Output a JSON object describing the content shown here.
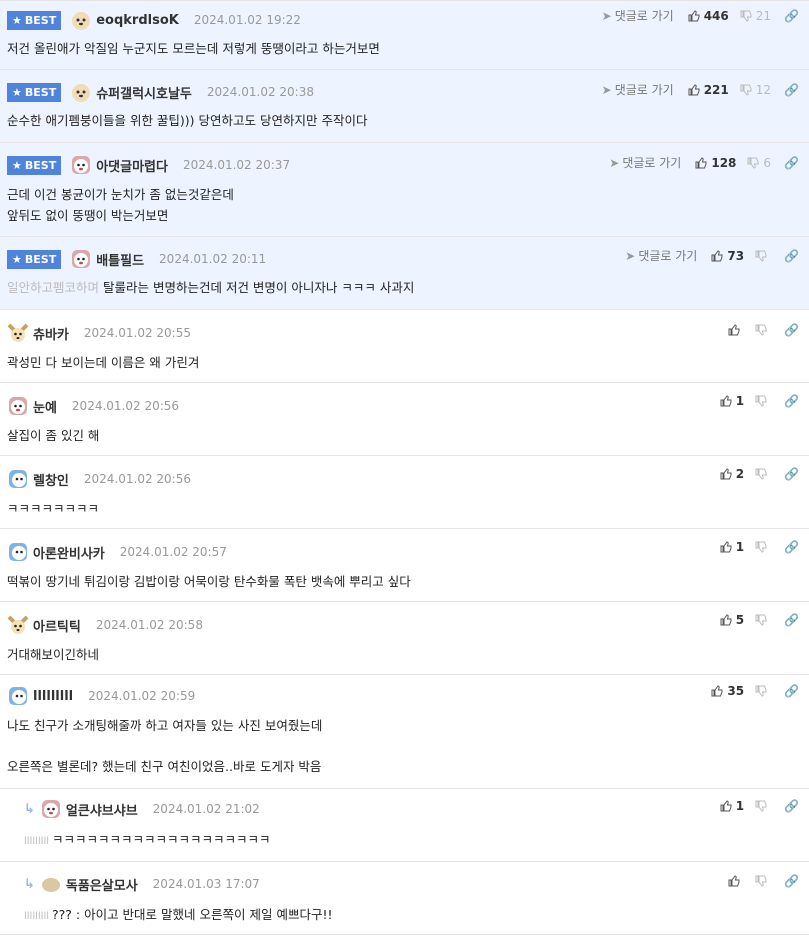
{
  "ui": {
    "best_label": "BEST",
    "goto_label": "댓글로 가기"
  },
  "comments": [
    {
      "nick": "eoqkrdlsoK",
      "date": "2024.01.02 19:22",
      "text": "저건 올린애가 악질임 누군지도 모르는데 저렇게 뚱땡이라고 하는거보면",
      "likes": "446",
      "dislikes": "21"
    },
    {
      "nick": "슈퍼갤럭시호날두",
      "date": "2024.01.02 20:38",
      "text": "순수한 애기펨붕이들을 위한 꿀팁))) 당연하고도 당연하지만 주작이다",
      "likes": "221",
      "dislikes": "12"
    },
    {
      "nick": "아댓글마렵다",
      "date": "2024.01.02 20:37",
      "text": "근데 이건 봉균이가 눈치가 좀 없는것같은데",
      "text2": "앞뒤도 없이 뚱땡이 박는거보면",
      "likes": "128",
      "dislikes": "6"
    },
    {
      "nick": "배틀필드",
      "date": "2024.01.02 20:11",
      "prefix": "일안하고펨코하며",
      "text": "탈룰라는 변명하는건데 저건 변명이 아니자나 ㅋㅋㅋ 사과지",
      "likes": "73",
      "dislikes": ""
    },
    {
      "nick": "츄바카",
      "date": "2024.01.02 20:55",
      "text": "곽성민 다 보이는데 이름은 왜 가린겨",
      "likes": ""
    },
    {
      "nick": "눈예",
      "date": "2024.01.02 20:56",
      "text": "살집이 좀 있긴 해",
      "likes": "1"
    },
    {
      "nick": "렐창인",
      "date": "2024.01.02 20:56",
      "text": "ㅋㅋㅋㅋㅋㅋㅋㅋ",
      "likes": "2"
    },
    {
      "nick": "아론완비사카",
      "date": "2024.01.02 20:57",
      "text": "떡볶이 땅기네 튀김이랑 김밥이랑 어묵이랑 탄수화물 폭탄 뱃속에 뿌리고 싶다",
      "likes": "1"
    },
    {
      "nick": "아르틱틱",
      "date": "2024.01.02 20:58",
      "text": "거대해보이긴하네",
      "likes": "5"
    },
    {
      "nick": "lllllllll",
      "date": "2024.01.02 20:59",
      "text": "나도 친구가 소개팅해줄까 하고 여자들 있는 사진 보여줬는데",
      "text2": "오른쪽은 별론데? 했는데 친구 여친이었음..바로 도게자 박음",
      "likes": "35"
    },
    {
      "nick": "얼큰샤브샤브",
      "date": "2024.01.02 21:02",
      "mention": "lllllllll",
      "text": "ㅋㅋㅋㅋㅋㅋㅋㅋㅋㅋㅋㅋㅋㅋㅋㅋㅋㅋㅋ",
      "likes": "1"
    },
    {
      "nick": "독품은살모사",
      "date": "2024.01.03 17:07",
      "mention": "lllllllll",
      "text": "??? : 아이고 반대로 말했네 오른쪽이 제일 예쁘다구!!",
      "likes": ""
    }
  ]
}
